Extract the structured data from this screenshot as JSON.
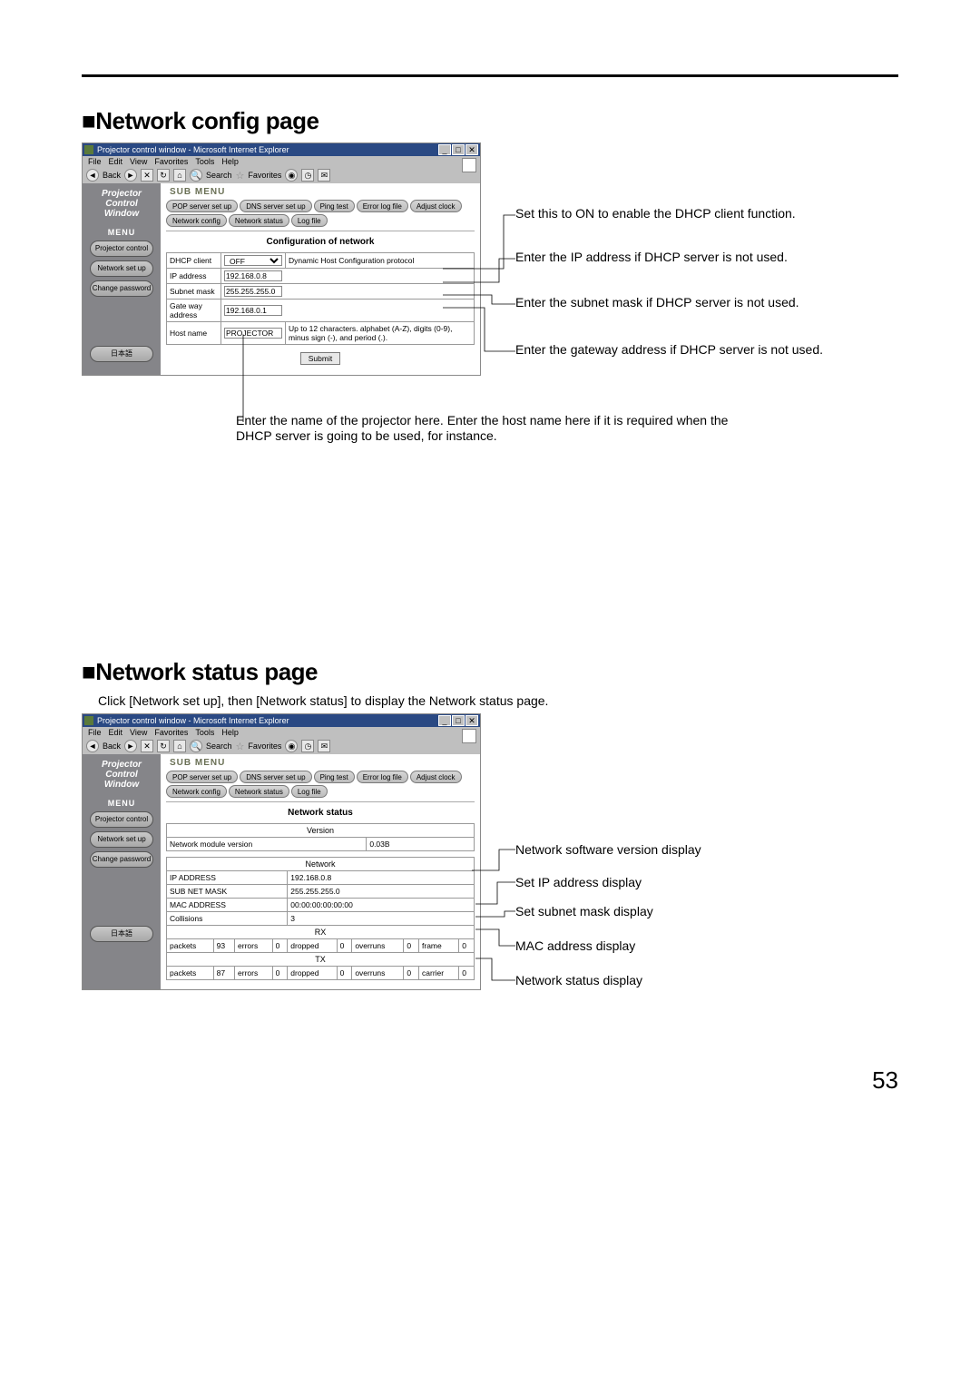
{
  "pageNumber": "53",
  "sec1": {
    "heading": "Network config page",
    "window": {
      "title": "Projector control window - Microsoft Internet Explorer",
      "menubar": [
        "File",
        "Edit",
        "View",
        "Favorites",
        "Tools",
        "Help"
      ],
      "toolbar": {
        "back": "Back",
        "search": "Search",
        "favorites": "Favorites"
      },
      "brand1": "Projector",
      "brand2": "Control",
      "brand3": "Window",
      "subMenu": "SUB MENU",
      "tabs": [
        "POP server set up",
        "DNS server set up",
        "Ping test",
        "Error log file",
        "Adjust clock",
        "Network config",
        "Network status",
        "Log file"
      ],
      "menuHead": "MENU",
      "menuBtns": [
        "Projector control",
        "Network set up",
        "Change password",
        "日本語"
      ],
      "title2": "Configuration of network",
      "rows": {
        "dhcp": {
          "label": "DHCP client",
          "value": "OFF",
          "desc": "Dynamic Host Configuration protocol"
        },
        "ip": {
          "label": "IP address",
          "value": "192.168.0.8"
        },
        "mask": {
          "label": "Subnet mask",
          "value": "255.255.255.0"
        },
        "gw": {
          "label": "Gate way address",
          "value": "192.168.0.1"
        },
        "host": {
          "label": "Host name",
          "value": "PROJECTOR",
          "desc": "Up to 12 characters. alphabet (A-Z), digits (0-9), minus sign (-), and period (.)."
        }
      },
      "submit": "Submit"
    },
    "callouts": {
      "dhcp": "Set this to ON to enable the DHCP client function.",
      "ip": "Enter the IP address if DHCP server is not used.",
      "mask": "Enter the subnet mask if DHCP server is not used.",
      "gw": "Enter the gateway address if DHCP server is not used.",
      "host": "Enter the name of the projector here. Enter the host name here if it is required when the DHCP server is going to be used, for instance."
    }
  },
  "sec2": {
    "heading": "Network status page",
    "intro": "Click [Network set up], then [Network status] to display the Network status page.",
    "title2": "Network status",
    "versionHead": "Version",
    "versionLabel": "Network module version",
    "versionValue": "0.03B",
    "networkHead": "Network",
    "rows": {
      "ip": {
        "label": "IP ADDRESS",
        "value": "192.168.0.8"
      },
      "mask": {
        "label": "SUB NET MASK",
        "value": "255.255.255.0"
      },
      "mac": {
        "label": "MAC ADDRESS",
        "value": "00:00:00:00:00:00"
      },
      "coll": {
        "label": "Collisions",
        "value": "3"
      }
    },
    "rxHead": "RX",
    "txHead": "TX",
    "cols": {
      "packets": "packets",
      "errors": "errors",
      "dropped": "dropped",
      "overruns": "overruns",
      "frame": "frame",
      "carrier": "carrier"
    },
    "rx": {
      "packets": "93",
      "errors": "0",
      "dropped": "0",
      "overruns": "0",
      "frame": "0"
    },
    "tx": {
      "packets": "87",
      "errors": "0",
      "dropped": "0",
      "overruns": "0",
      "carrier": "0"
    },
    "callouts": {
      "ver": "Network software version display",
      "ip": "Set IP address display",
      "mask": "Set subnet mask display",
      "mac": "MAC address display",
      "status": "Network status display"
    }
  }
}
